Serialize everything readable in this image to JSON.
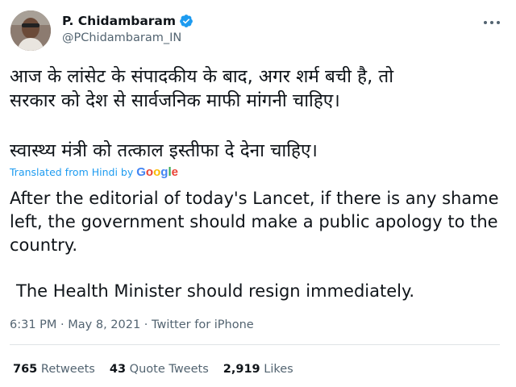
{
  "author": {
    "name": "P. Chidambaram",
    "handle": "@PChidambaram_IN",
    "verified": true
  },
  "tweet": {
    "hindi_line1": "आज के लांसेट के संपादकीय के बाद, अगर शर्म बची है, तो\nसरकार को देश से सार्वजनिक माफी मांगनी चाहिए।",
    "hindi_line2": "स्वास्थ्य मंत्री को तत्काल इस्तीफा दे देना चाहिए।",
    "translated_label": "Translated from Hindi by",
    "translator_brand": "Google",
    "english_line1": "After the editorial of today's Lancet, if there is any shame left, the government should make a public apology to the country.",
    "english_line2": "The Health Minister should resign immediately.",
    "meta": "6:31 PM · May 8, 2021 · Twitter for iPhone"
  },
  "stats": {
    "retweets_count": "765",
    "retweets_label": "Retweets",
    "quotes_count": "43",
    "quotes_label": "Quote Tweets",
    "likes_count": "2,919",
    "likes_label": "Likes"
  },
  "colors": {
    "link": "#1d9bf0",
    "secondary_text": "#536471",
    "primary_text": "#0f1419",
    "verified_badge": "#1d9bf0"
  },
  "icons": {
    "verified": "verified-badge-icon",
    "more": "more-options-icon"
  }
}
